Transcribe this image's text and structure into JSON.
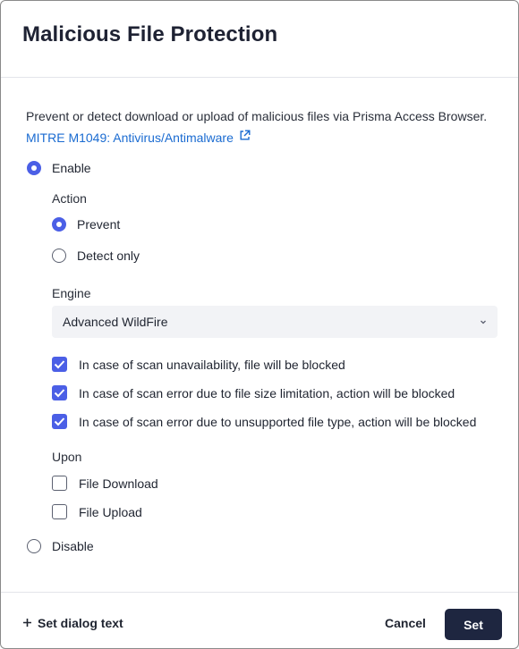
{
  "dialog": {
    "title": "Malicious File Protection",
    "description": "Prevent or detect download or upload of malicious files via Prisma Access Browser.",
    "mitre_link": "MITRE M1049: Antivirus/Antimalware",
    "enable_label": "Enable",
    "disable_label": "Disable",
    "selected_mode": "Enable",
    "action": {
      "heading": "Action",
      "options": [
        {
          "label": "Prevent",
          "selected": true
        },
        {
          "label": "Detect only",
          "selected": false
        }
      ]
    },
    "engine": {
      "heading": "Engine",
      "value": "Advanced WildFire"
    },
    "checks": [
      {
        "label": "In case of scan unavailability, file will be blocked",
        "checked": true
      },
      {
        "label": "In case of scan error due to file size limitation, action will be blocked",
        "checked": true
      },
      {
        "label": "In case of scan error due to unsupported file type, action will be blocked",
        "checked": true
      }
    ],
    "upon": {
      "heading": "Upon",
      "options": [
        {
          "label": "File Download",
          "checked": false
        },
        {
          "label": "File Upload",
          "checked": false
        }
      ]
    }
  },
  "footer": {
    "set_dialog_text": "Set dialog text",
    "cancel_label": "Cancel",
    "set_label": "Set"
  },
  "colors": {
    "accent": "#4b5fe6",
    "link": "#1a6bd1",
    "primary_button": "#1e2640"
  }
}
